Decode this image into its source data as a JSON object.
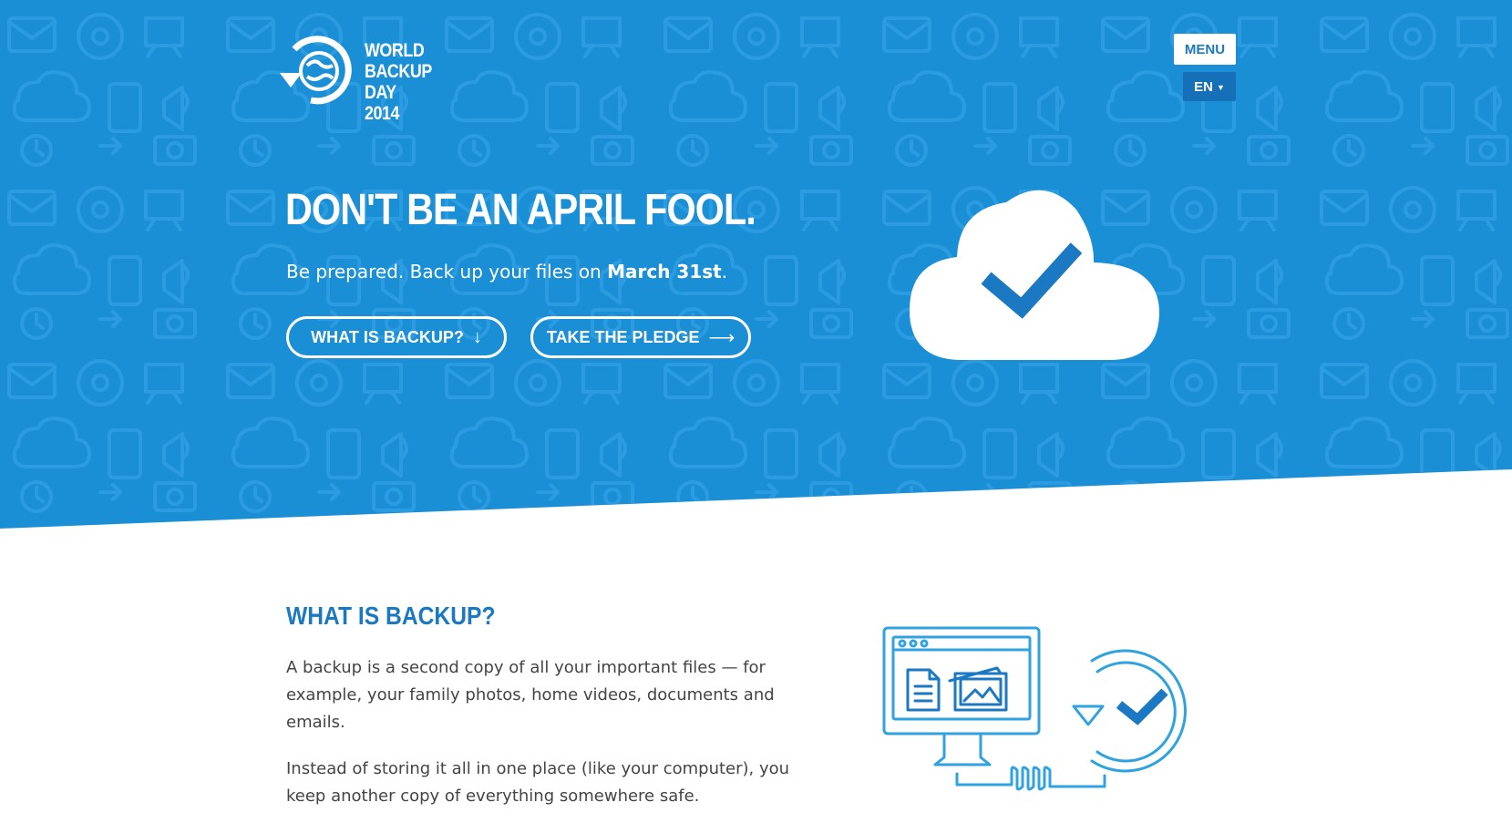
{
  "brand": {
    "logo_lines": [
      "WORLD",
      "BACKUP",
      "DAY 2014"
    ]
  },
  "nav": {
    "menu_label": "MENU",
    "language_label": "EN"
  },
  "hero": {
    "headline": "DON'T BE AN APRIL FOOL.",
    "subline_prefix": "Be prepared. Back up your files on ",
    "subline_date": "March 31st",
    "subline_suffix": ".",
    "buttons": [
      {
        "label": "WHAT IS BACKUP?",
        "arrow": "↓"
      },
      {
        "label": "TAKE THE PLEDGE",
        "arrow": "⟶"
      }
    ]
  },
  "section": {
    "title": "WHAT IS BACKUP?",
    "paragraphs": [
      "A backup is a second copy of all your important files — for example, your family photos, home videos, documents and emails.",
      "Instead of storing it all in one place (like your computer), you keep another copy of everything somewhere safe."
    ]
  },
  "colors": {
    "hero_blue": "#1a8fd6",
    "accent_blue": "#1a79c2",
    "illustration_blue": "#2fa2e0",
    "text_gray": "#444444"
  }
}
